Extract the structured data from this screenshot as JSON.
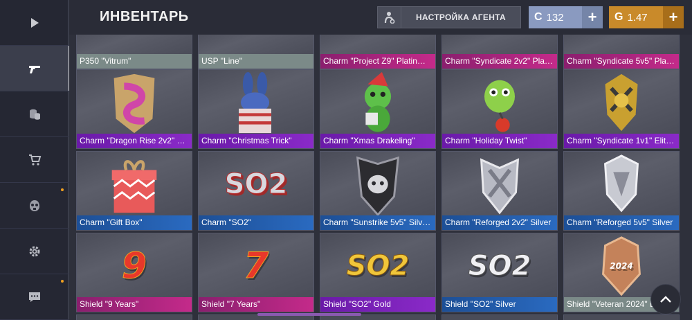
{
  "header": {
    "title": "ИНВЕНТАРЬ",
    "agent_button": "НАСТРОЙКА АГЕНТА",
    "silver": {
      "glyph": "C",
      "value": "132",
      "plus": "+"
    },
    "gold": {
      "glyph": "G",
      "value": "1.47",
      "plus": "+"
    }
  },
  "sidebar": {
    "items": [
      {
        "icon": "play-icon",
        "active": false,
        "dot": false
      },
      {
        "icon": "pistol-icon",
        "active": true,
        "dot": false
      },
      {
        "icon": "coins-icon",
        "active": false,
        "dot": false
      },
      {
        "icon": "cart-icon",
        "active": false,
        "dot": false
      },
      {
        "icon": "gas-mask-icon",
        "active": false,
        "dot": true
      },
      {
        "icon": "gear-icon",
        "active": false,
        "dot": false
      },
      {
        "icon": "chat-icon",
        "active": false,
        "dot": false
      }
    ]
  },
  "inventory": {
    "rows": [
      [
        {
          "name": "P350 \"Vitrum\"",
          "rarity": "gray"
        },
        {
          "name": "USP \"Line\"",
          "rarity": "gray"
        },
        {
          "name": "Charm \"Project Z9\" Platin…",
          "rarity": "pink"
        },
        {
          "name": "Charm \"Syndicate 2v2\" Pla…",
          "rarity": "pink"
        },
        {
          "name": "Charm \"Syndicate 5v5\" Pla…",
          "rarity": "pink"
        }
      ],
      [
        {
          "name": "Charm \"Dragon Rise 2v2\" …",
          "rarity": "purple",
          "art": "dragon-rise-badge"
        },
        {
          "name": "Charm \"Christmas Trick\"",
          "rarity": "purple",
          "art": "bunny-gift"
        },
        {
          "name": "Charm \"Xmas Drakeling\"",
          "rarity": "purple",
          "art": "green-dragon"
        },
        {
          "name": "Charm \"Holiday Twist\"",
          "rarity": "purple",
          "art": "green-head"
        },
        {
          "name": "Charm \"Syndicate 1v1\" Elit…",
          "rarity": "purple",
          "art": "gold-badge"
        }
      ],
      [
        {
          "name": "Charm \"Gift Box\"",
          "rarity": "blue",
          "art": "gift-box"
        },
        {
          "name": "Charm \"SO2\"",
          "rarity": "blue",
          "art": "so2-red"
        },
        {
          "name": "Charm \"Sunstrike 5v5\" Silv…",
          "rarity": "blue",
          "art": "dark-shield"
        },
        {
          "name": "Charm \"Reforged 2v2\" Silver",
          "rarity": "blue",
          "art": "silver-shield"
        },
        {
          "name": "Charm \"Reforged 5v5\" Silver",
          "rarity": "blue",
          "art": "silver-crest"
        }
      ],
      [
        {
          "name": "Shield \"9 Years\"",
          "rarity": "pink",
          "art": "nine-fire",
          "art_text": "9"
        },
        {
          "name": "Shield \"7 Years\"",
          "rarity": "pink",
          "art": "seven-fire",
          "art_text": "7"
        },
        {
          "name": "Shield \"SO2\" Gold",
          "rarity": "purple",
          "art": "so2-gold",
          "art_text": "SO2"
        },
        {
          "name": "Shield \"SO2\" Silver",
          "rarity": "blue",
          "art": "so2-silver",
          "art_text": "SO2"
        },
        {
          "name": "Shield \"Veteran 2024\" Bro…",
          "rarity": "gray",
          "art": "veteran-2024",
          "art_text": "2024"
        }
      ]
    ],
    "so2_text": "SO2"
  },
  "colors": {
    "background": "#2b2d38",
    "rarity_gray": "#7b8a88",
    "rarity_pink": "#b8287f",
    "rarity_purple": "#7b24b8",
    "rarity_blue": "#2462ae",
    "silver_currency": "#8a9ac0",
    "gold_currency": "#c98a2a"
  }
}
